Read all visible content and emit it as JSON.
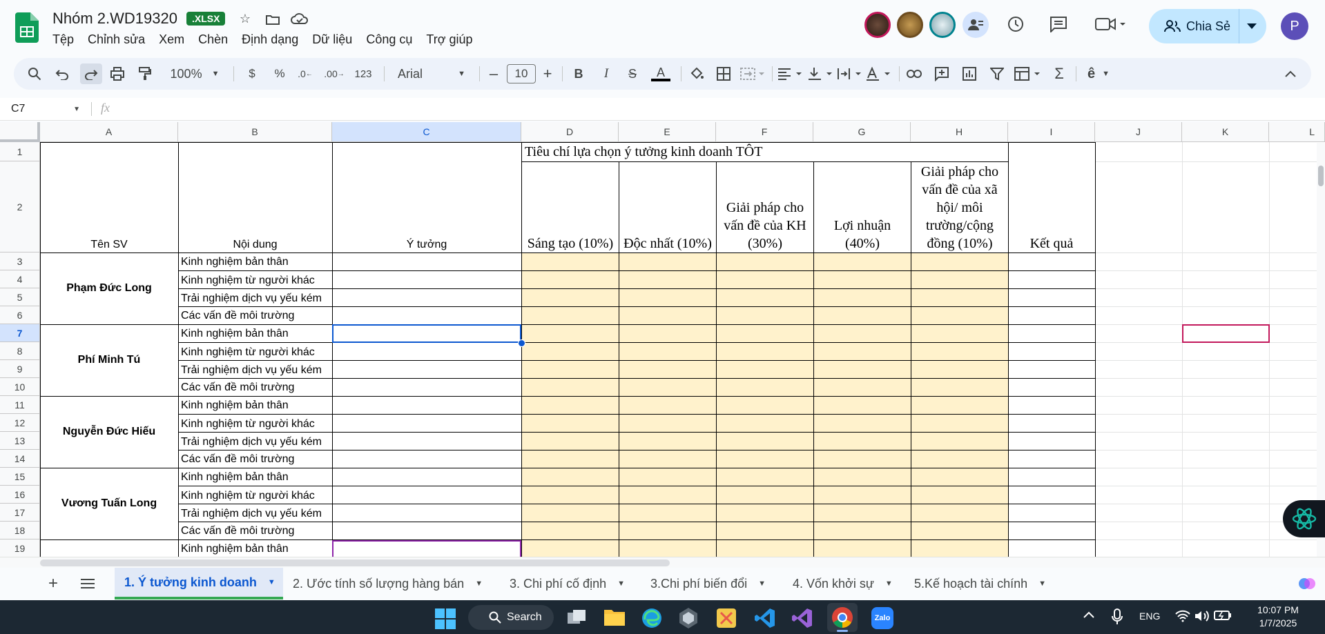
{
  "header": {
    "doc_title": "Nhóm 2.WD19320",
    "format_badge": ".XLSX",
    "share_label": "Chia Sẻ",
    "profile_initial": "P",
    "menu": [
      "Tệp",
      "Chỉnh sửa",
      "Xem",
      "Chèn",
      "Định dạng",
      "Dữ liệu",
      "Công cụ",
      "Trợ giúp"
    ]
  },
  "toolbar": {
    "zoom": "100%",
    "currency": "$",
    "percent": "%",
    "dec_dec": ".0",
    "inc_dec": ".00",
    "number_format": "123",
    "font": "Arial",
    "font_size": "10"
  },
  "formula_bar": {
    "name_box": "C7",
    "fx": "fx",
    "value": ""
  },
  "grid": {
    "columns": [
      "A",
      "B",
      "C",
      "D",
      "E",
      "F",
      "G",
      "H",
      "I",
      "J",
      "K",
      "L"
    ],
    "rows": [
      "1",
      "2",
      "3",
      "4",
      "5",
      "6",
      "7",
      "8",
      "9",
      "10",
      "11",
      "12",
      "13",
      "14",
      "15",
      "16",
      "17",
      "18",
      "19"
    ],
    "title_row": "Tiêu chí lựa chọn ý tưởng kinh doanh TÔT",
    "headers": {
      "a": "Tên SV",
      "b": "Nội dung",
      "c": "Ý tưởng",
      "d": "Sáng tạo (10%)",
      "e": "Độc nhất (10%)",
      "f": "Giải pháp cho vấn đề của KH (30%)",
      "g": "Lợi nhuận (40%)",
      "h": "Giải pháp cho vấn đề của xã hội/ môi trường/cộng đồng (10%)",
      "i": "Kết quả"
    },
    "students": [
      "Phạm Đức Long",
      "Phí Minh Tú",
      "Nguyễn Đức Hiếu",
      "Vương Tuấn Long"
    ],
    "contents": [
      "Kinh nghiệm bản thân",
      "Kinh nghiệm từ người khác",
      "Trải nghiệm dịch vụ yếu kém",
      "Các vấn đề môi trường"
    ],
    "row19_content": "Kinh nghiệm bản thân"
  },
  "sheets": {
    "tabs": [
      "1. Ý tưởng kinh doanh",
      "2. Ước tính số lượng hàng bán",
      "3. Chi phí cố định",
      "3.Chi phí biến đổi",
      "4. Vốn khởi sự",
      "5.Kế hoạch tài chính"
    ],
    "active": 0
  },
  "taskbar": {
    "search": "Search",
    "lang": "ENG",
    "time": "10:07 PM",
    "date": "1/7/2025"
  },
  "colors": {
    "accent": "#0b57d0",
    "highlight_yellow": "#fff2cc",
    "share_bg": "#c2e7ff",
    "sheets_green": "#188038"
  }
}
